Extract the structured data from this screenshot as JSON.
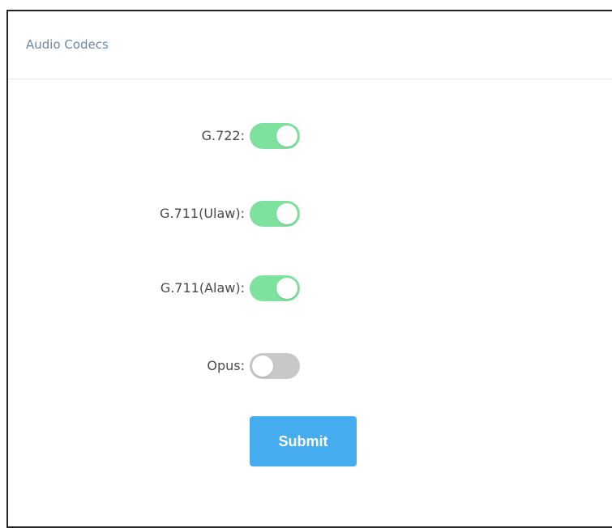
{
  "panel": {
    "title": "Audio Codecs"
  },
  "codecs": [
    {
      "label": "G.722:",
      "enabled": true
    },
    {
      "label": "G.711(Ulaw):",
      "enabled": true
    },
    {
      "label": "G.711(Alaw):",
      "enabled": true
    },
    {
      "label": "Opus:",
      "enabled": false
    }
  ],
  "actions": {
    "submit_label": "Submit"
  },
  "colors": {
    "toggle_on": "#7ee29f",
    "toggle_off": "#c8c8c8",
    "submit_bg": "#44acef",
    "title_text": "#6d87a8"
  }
}
